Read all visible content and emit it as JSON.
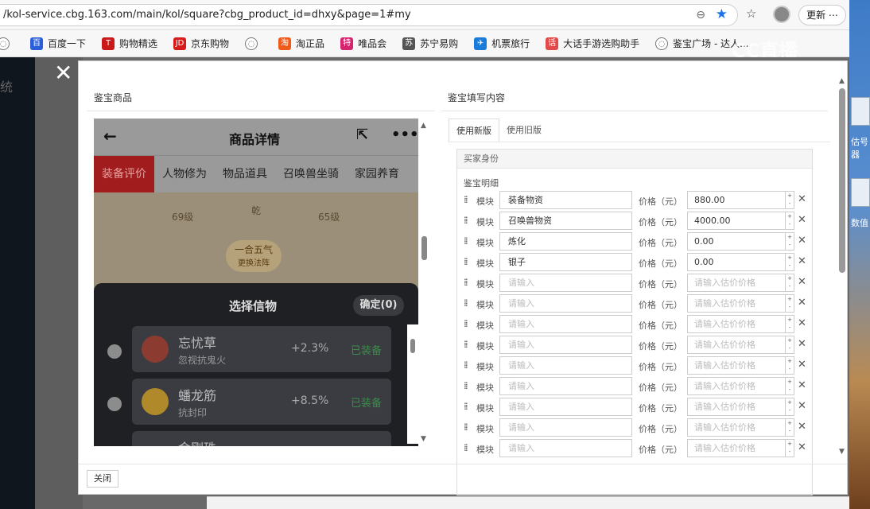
{
  "browser": {
    "url": "/kol-service.cbg.163.com/main/kol/square?cbg_product_id=dhxy&page=1#my",
    "update_label": "更新",
    "bookmarks": [
      "百度一下",
      "购物精选",
      "京东购物",
      "",
      "淘正品",
      "唯品会",
      "苏宁易购",
      "机票旅行",
      "大话手游选购助手",
      "鉴宝广场 - 达人..."
    ],
    "watermark": "CC直播"
  },
  "page": {
    "nav_title": "统"
  },
  "modal": {
    "left_title": "鉴宝商品",
    "right_title": "鉴宝填写内容",
    "close_button": "关闭",
    "phone": {
      "title": "商品详情",
      "tabs": [
        "装备评价",
        "人物修为",
        "物品道具",
        "召唤兽坐骑",
        "家园养育"
      ],
      "body_texts": [
        "69级",
        "65级",
        "乾",
        "一合五气",
        "更换法阵"
      ],
      "sheet_title": "选择信物",
      "confirm": "确定(0)",
      "items": [
        {
          "name": "忘忧草",
          "sub": "忽视抗鬼火",
          "pct": "+2.3%",
          "status": "已装备"
        },
        {
          "name": "蟠龙筋",
          "sub": "抗封印",
          "pct": "+8.5%",
          "status": "已装备"
        },
        {
          "name": "金刚珠",
          "sub": "",
          "pct": "",
          "status": ""
        }
      ]
    },
    "tabs": [
      "使用新版",
      "使用旧版"
    ],
    "buyer_label": "买家身份",
    "detail_label": "鉴宝明细",
    "row_labels": {
      "module": "模块",
      "price": "价格（元）"
    },
    "rows": [
      {
        "module": "装备物资",
        "price": "880.00"
      },
      {
        "module": "召唤兽物资",
        "price": "4000.00"
      },
      {
        "module": "炼化",
        "price": "0.00"
      },
      {
        "module": "银子",
        "price": "0.00"
      },
      {
        "module": "",
        "price": ""
      },
      {
        "module": "",
        "price": ""
      },
      {
        "module": "",
        "price": ""
      },
      {
        "module": "",
        "price": ""
      },
      {
        "module": "",
        "price": ""
      },
      {
        "module": "",
        "price": ""
      },
      {
        "module": "",
        "price": ""
      },
      {
        "module": "",
        "price": ""
      },
      {
        "module": "",
        "price": ""
      }
    ],
    "placeholders": {
      "module": "请输入",
      "price": "请输入估价价格"
    }
  },
  "desktop": {
    "icon_labels": [
      "估号器",
      "数值"
    ]
  }
}
